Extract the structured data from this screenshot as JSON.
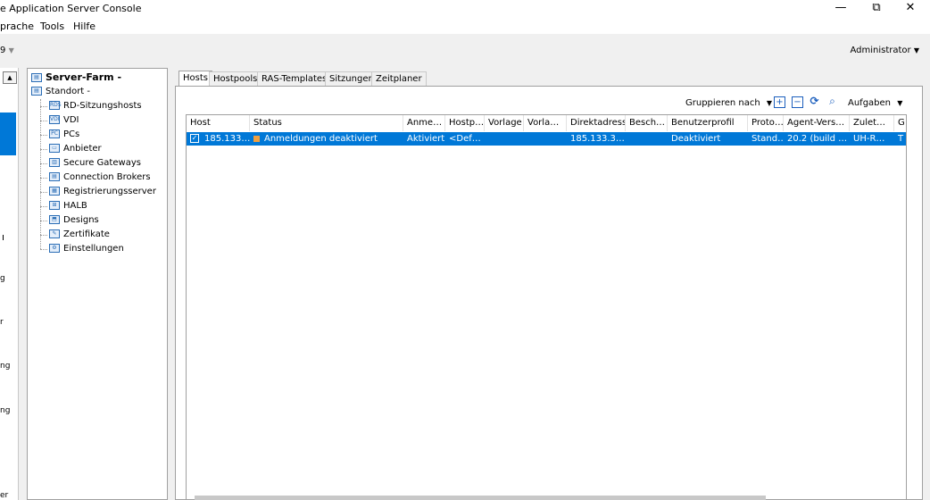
{
  "window": {
    "title": "e Application Server Console",
    "minimize": "—",
    "restore": "⧉",
    "close": "✕"
  },
  "menu": [
    "prache",
    "Tools",
    "Hilfe"
  ],
  "toolbar": {
    "left_fragment": "9",
    "user": "Administrator"
  },
  "nav_fragments": [
    "g",
    "r",
    "ng",
    "ng",
    "er"
  ],
  "tree": {
    "root": "Server-Farm -",
    "site": "Standort -",
    "items": [
      {
        "label": "RD-Sitzungshosts",
        "icon": "rds-icon",
        "glyph": "RDS"
      },
      {
        "label": "VDI",
        "icon": "vdi-icon",
        "glyph": "VDI"
      },
      {
        "label": "PCs",
        "icon": "pc-icon",
        "glyph": "PC"
      },
      {
        "label": "Anbieter",
        "icon": "provider-icon",
        "glyph": "▭"
      },
      {
        "label": "Secure Gateways",
        "icon": "gateway-icon",
        "glyph": "▥"
      },
      {
        "label": "Connection Brokers",
        "icon": "broker-icon",
        "glyph": "▤"
      },
      {
        "label": "Registrierungsserver",
        "icon": "registration-server-icon",
        "glyph": "▦"
      },
      {
        "label": "HALB",
        "icon": "halb-icon",
        "glyph": "⊞"
      },
      {
        "label": "Designs",
        "icon": "designs-icon",
        "glyph": "⬒"
      },
      {
        "label": "Zertifikate",
        "icon": "certificate-icon",
        "glyph": "✎"
      },
      {
        "label": "Einstellungen",
        "icon": "settings-gear-icon",
        "glyph": "⚙"
      }
    ]
  },
  "tabs": [
    "Hosts",
    "Hostpools",
    "RAS-Templates",
    "Sitzungen",
    "Zeitplaner"
  ],
  "actions": {
    "group_by": "Gruppieren nach",
    "tasks": "Aufgaben",
    "icons": [
      "add-icon",
      "remove-icon",
      "refresh-icon",
      "search-icon"
    ]
  },
  "table": {
    "columns": [
      "Host",
      "Status",
      "Anme…",
      "Hostp…",
      "Vorlage",
      "Vorla…",
      "Direktadresse",
      "Besch…",
      "Benutzerprofil",
      "Proto…",
      "Agent-Vers…",
      "Zulet…",
      "G"
    ],
    "rows": [
      {
        "checked": true,
        "cells": [
          "185.133…",
          "Anmeldungen deaktiviert",
          "Aktiviert",
          "<Def…",
          "",
          "",
          "185.133.3…",
          "",
          "Deaktiviert",
          "Stand…",
          "20.2 (build …",
          "UH-R…",
          "T"
        ]
      }
    ]
  },
  "colors": {
    "selection": "#0078d7",
    "status_warning": "#f0a040"
  }
}
